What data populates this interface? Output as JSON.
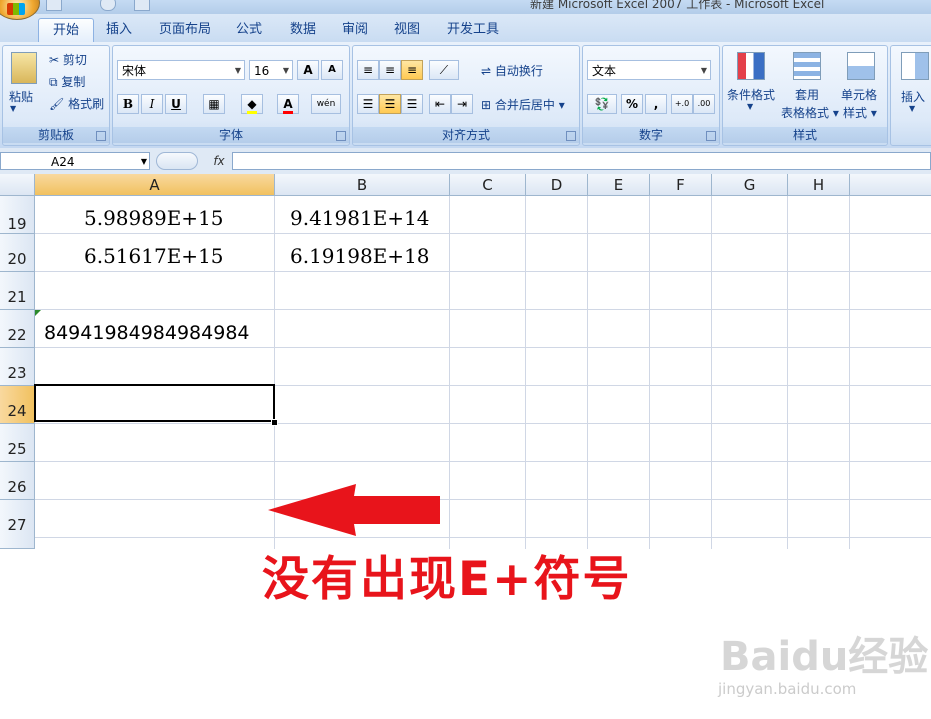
{
  "window": {
    "title": "新建 Microsoft Excel 2007 工作表 - Microsoft Excel"
  },
  "ribbon_tabs": [
    "开始",
    "插入",
    "页面布局",
    "公式",
    "数据",
    "审阅",
    "视图",
    "开发工具"
  ],
  "active_tab": "开始",
  "clipboard": {
    "paste": "粘贴",
    "cut": "剪切",
    "copy": "复制",
    "format_painter": "格式刷",
    "group_label": "剪贴板"
  },
  "font": {
    "name": "宋体",
    "size": "16",
    "grow": "A",
    "shrink": "A",
    "bold": "B",
    "italic": "I",
    "underline": "U",
    "font_color_glyph": "A",
    "phonetic": "wén",
    "group_label": "字体"
  },
  "alignment": {
    "wrap_text": "自动换行",
    "merge_center": "合并后居中",
    "group_label": "对齐方式"
  },
  "number": {
    "format": "文本",
    "percent": "%",
    "comma": ",",
    "group_label": "数字"
  },
  "styles": {
    "conditional_formatting": "条件格式",
    "format_as_table_line1": "套用",
    "format_as_table_line2": "表格格式",
    "cell_styles_line1": "单元格",
    "cell_styles_line2": "样式",
    "group_label": "样式"
  },
  "cells_group": {
    "insert": "插入"
  },
  "formula_bar": {
    "name_box": "A24",
    "fx": "fx",
    "formula": ""
  },
  "columns": [
    "A",
    "B",
    "C",
    "D",
    "E",
    "F",
    "G",
    "H"
  ],
  "active_column": "A",
  "rows": [
    "19",
    "20",
    "21",
    "22",
    "23",
    "24",
    "25",
    "26",
    "27"
  ],
  "active_row": "24",
  "cells": {
    "A19": "5.98989E+15",
    "B19": "9.41981E+14",
    "A20": "6.51617E+15",
    "B20": "6.19198E+18",
    "A22": "84941984984984984"
  },
  "annotation": {
    "text": "没有出现E+符号",
    "color": "#e8141b"
  },
  "watermark": {
    "brand": "Baidu经验",
    "url": "jingyan.baidu.com"
  },
  "colors": {
    "ribbon": "#dbe8f7",
    "selection_header": "#f1c15f",
    "arrow": "#e8141b"
  }
}
